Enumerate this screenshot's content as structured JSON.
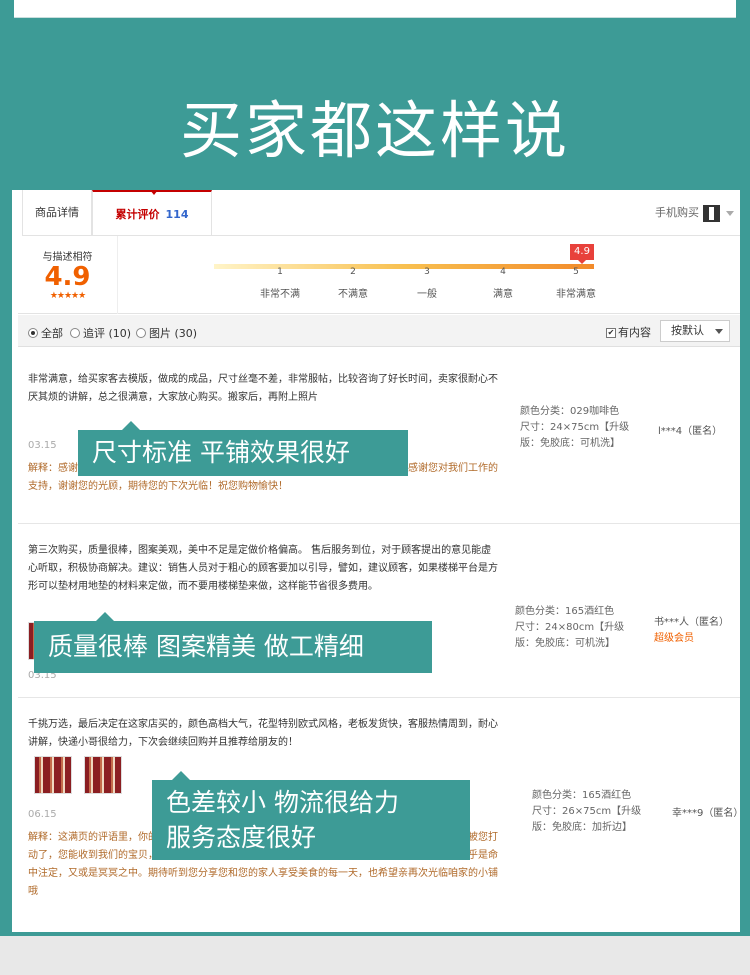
{
  "headline": "买家都这样说",
  "tabs": {
    "details": "商品详情",
    "reviews_label": "累计评价",
    "reviews_count": "114",
    "mobile_buy": "手机购买"
  },
  "rating": {
    "label": "与描述相符",
    "score": "4.9",
    "stars": "★★★★★",
    "flag": "4.9",
    "scale": [
      {
        "num": "1",
        "label": "非常不满"
      },
      {
        "num": "2",
        "label": "不满意"
      },
      {
        "num": "3",
        "label": "一般"
      },
      {
        "num": "4",
        "label": "满意"
      },
      {
        "num": "5",
        "label": "非常满意"
      }
    ]
  },
  "filters": {
    "all": "全部",
    "followup": "追评 (10)",
    "pictures": "图片 (30)",
    "has_content": "有内容",
    "sort": "按默认"
  },
  "reviews": [
    {
      "text": "非常满意，给买家客去模版，做成的成品，尺寸丝毫不差，非常服帖，比较咨询了好长时间，卖家很耐心不厌其烦的讲解，总之很满意，大家放心购买。搬家后，再附上照片",
      "date": "03.15",
      "reply": "解释：感谢您对我们的支持，您的满意是我们最大的动力，也是我们不断进步的动力，感谢您对我们工作的支持，谢谢您的光顾，期待您的下次光临！祝您购物愉快！",
      "sku_color": "颜色分类：029咖啡色",
      "sku_size": "尺寸：24×75cm【升级",
      "sku_ver": "版：免胶底：可机洗】",
      "user": "l***4（匿名）",
      "callout": "尺寸标准  平铺效果很好"
    },
    {
      "text": "第三次购买，质量很棒，图案美观，美中不足是定做价格偏高。 售后服务到位，对于顾客提出的意见能虚心听取，积极协商解决。建议：销售人员对于粗心的顾客要加以引导，譬如，建议顾客，如果楼梯平台是方形可以垫材用地垫的材料来定做，而不要用楼梯垫来做，这样能节省很多费用。",
      "date": "03.15",
      "sku_color": "颜色分类：165酒红色",
      "sku_size": "尺寸：24×80cm【升级",
      "sku_ver": "版：免胶底：可机洗】",
      "user": "书***人（匿名）",
      "vip": "超级会员",
      "callout": "质量很棒  图案精美  做工精细"
    },
    {
      "text": "千挑万选，最后决定在这家店买的，颜色高档大气，花型特别欧式风格，老板发货快，客服热情周到，耐心讲解，快递小哥很给力，下次会继续回购并且推荐给朋友的！",
      "date": "06.15",
      "reply": "解释：这满页的评语里，你的每个字都耀眼夺目，感谢您的喜欢，是言言，是执着雅免。我们深深地被您打动了，您能收到我们的宝贝，谢谢亲在茫茫的淘海中，短暂的停留小铺，才会让我们遇见彼此。这似乎是命中注定，又或是冥冥之中。期待听到您分享您和您的家人享受美食的每一天，也希望亲再次光临咱家的小铺哦",
      "sku_color": "颜色分类：165酒红色",
      "sku_size": "尺寸：26×75cm【升级",
      "sku_ver": "版：免胶底：加折边】",
      "user": "幸***9（匿名）",
      "callout_line1": "色差较小  物流很给力",
      "callout_line2": "服务态度很好"
    }
  ]
}
